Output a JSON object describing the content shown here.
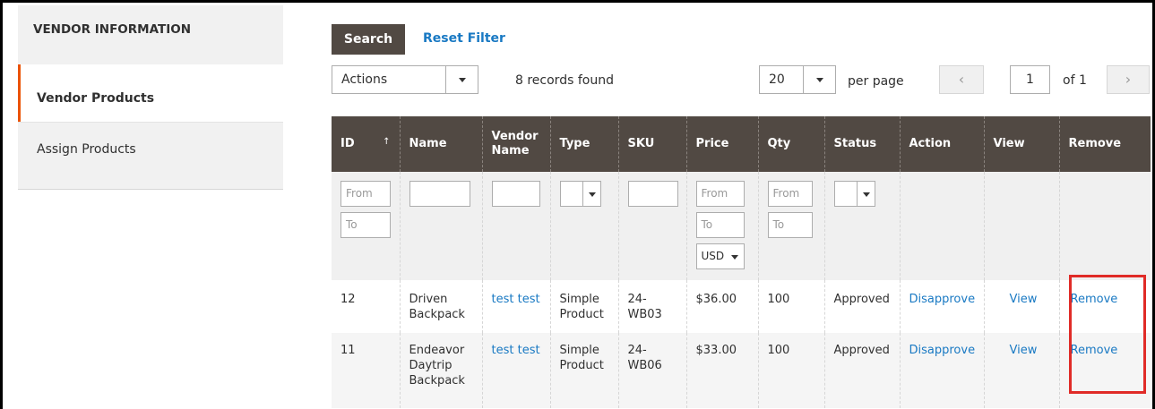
{
  "sidebar": {
    "title": "VENDOR INFORMATION",
    "items": [
      {
        "label": "Vendor Products",
        "active": true
      },
      {
        "label": "Assign Products",
        "active": false
      }
    ]
  },
  "toolbar": {
    "search_label": "Search",
    "reset_label": "Reset Filter",
    "actions_label": "Actions",
    "records_text": "8 records found",
    "per_page_value": "20",
    "per_page_label": "per page",
    "prev_icon": "‹",
    "next_icon": "›",
    "page_value": "1",
    "of_label": "of 1"
  },
  "table": {
    "columns": [
      "ID",
      "Name",
      "Vendor Name",
      "Type",
      "SKU",
      "Price",
      "Qty",
      "Status",
      "Action",
      "View",
      "Remove"
    ],
    "sort_marker": "↑",
    "filters": {
      "id_from": "From",
      "id_to": "To",
      "price_from": "From",
      "price_to": "To",
      "currency": "USD",
      "qty_from": "From",
      "qty_to": "To"
    },
    "rows": [
      {
        "id": "12",
        "name": "Driven Backpack",
        "vendor": "test test",
        "type": "Simple Product",
        "sku": "24-WB03",
        "price": "$36.00",
        "qty": "100",
        "status": "Approved",
        "action": "Disapprove",
        "view": "View",
        "remove": "Remove"
      },
      {
        "id": "11",
        "name": "Endeavor Daytrip Backpack",
        "vendor": "test test",
        "type": "Simple Product",
        "sku": "24-WB06",
        "price": "$33.00",
        "qty": "100",
        "status": "Approved",
        "action": "Disapprove",
        "view": "View",
        "remove": "Remove"
      }
    ]
  },
  "colors": {
    "header_bg": "#514943",
    "accent": "#eb5202",
    "link": "#1979c3",
    "highlight": "#e02b27"
  }
}
